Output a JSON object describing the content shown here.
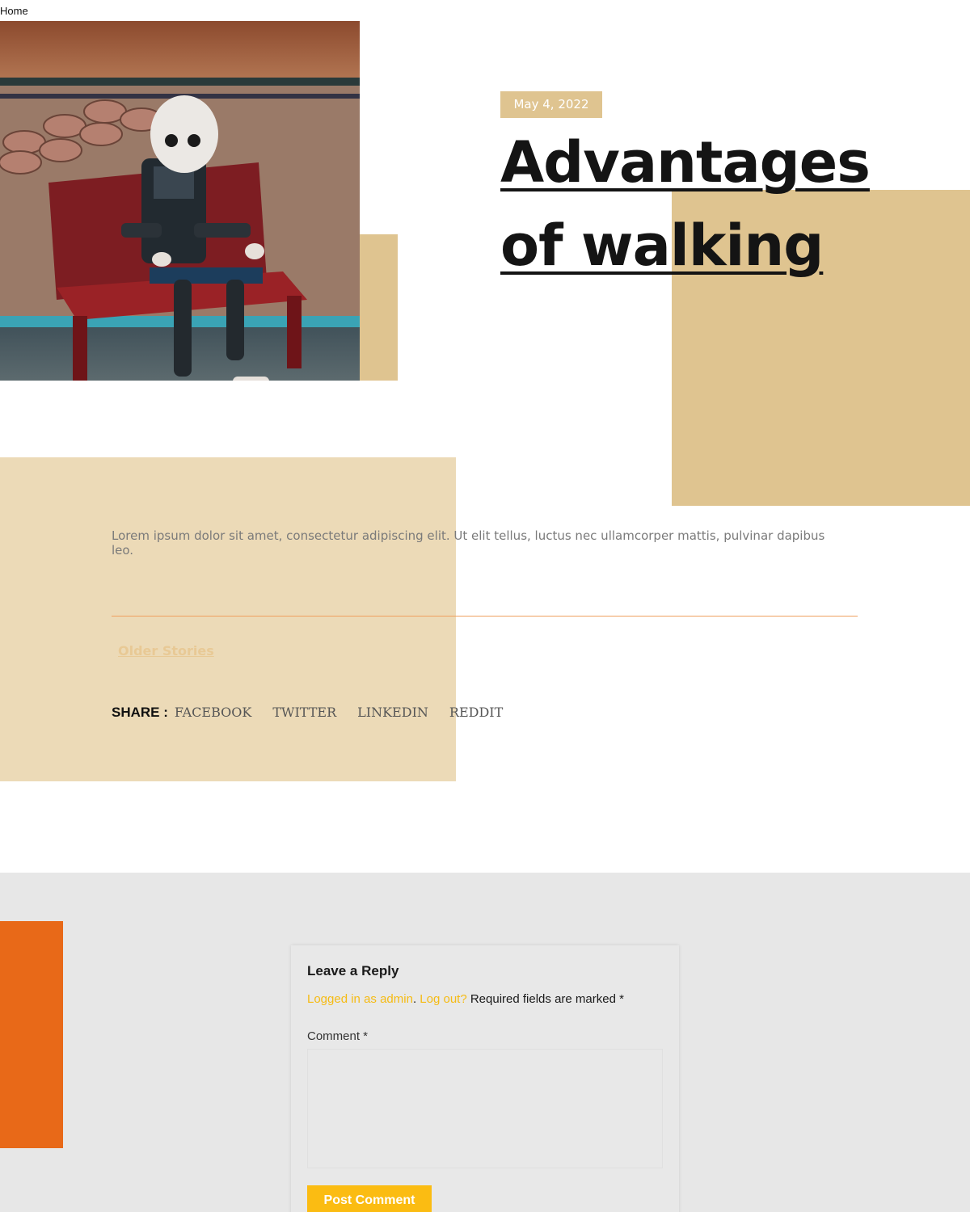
{
  "breadcrumb": {
    "home": "Home"
  },
  "post": {
    "date": "May 4, 2022",
    "title_line1": "Advantages",
    "title_line2": "of walking",
    "excerpt": "Lorem ipsum dolor sit amet, consectetur adipiscing elit. Ut elit tellus, luctus nec ullamcorper mattis, pulvinar dapibus leo.",
    "older_stories": "Older Stories"
  },
  "share": {
    "label": "SHARE :",
    "links": [
      "FACEBOOK",
      "TWITTER",
      "LINKEDIN",
      "REDDIT"
    ]
  },
  "comments": {
    "title": "Leave a Reply",
    "logged_in_link": "Logged in as admin",
    "separator": ". ",
    "logout_link": "Log out?",
    "required_text": " Required fields are marked *",
    "comment_label": "Comment *",
    "submit_label": "Post Comment"
  },
  "colors": {
    "tan": "#dfc490",
    "tan_light": "#ecdab7",
    "orange": "#e86918",
    "yellow": "#fbbc12",
    "link_yellow": "#f5bb14",
    "section_gray": "#e7e7e7"
  },
  "icons": {
    "hero": "robot-on-bench-photo"
  }
}
